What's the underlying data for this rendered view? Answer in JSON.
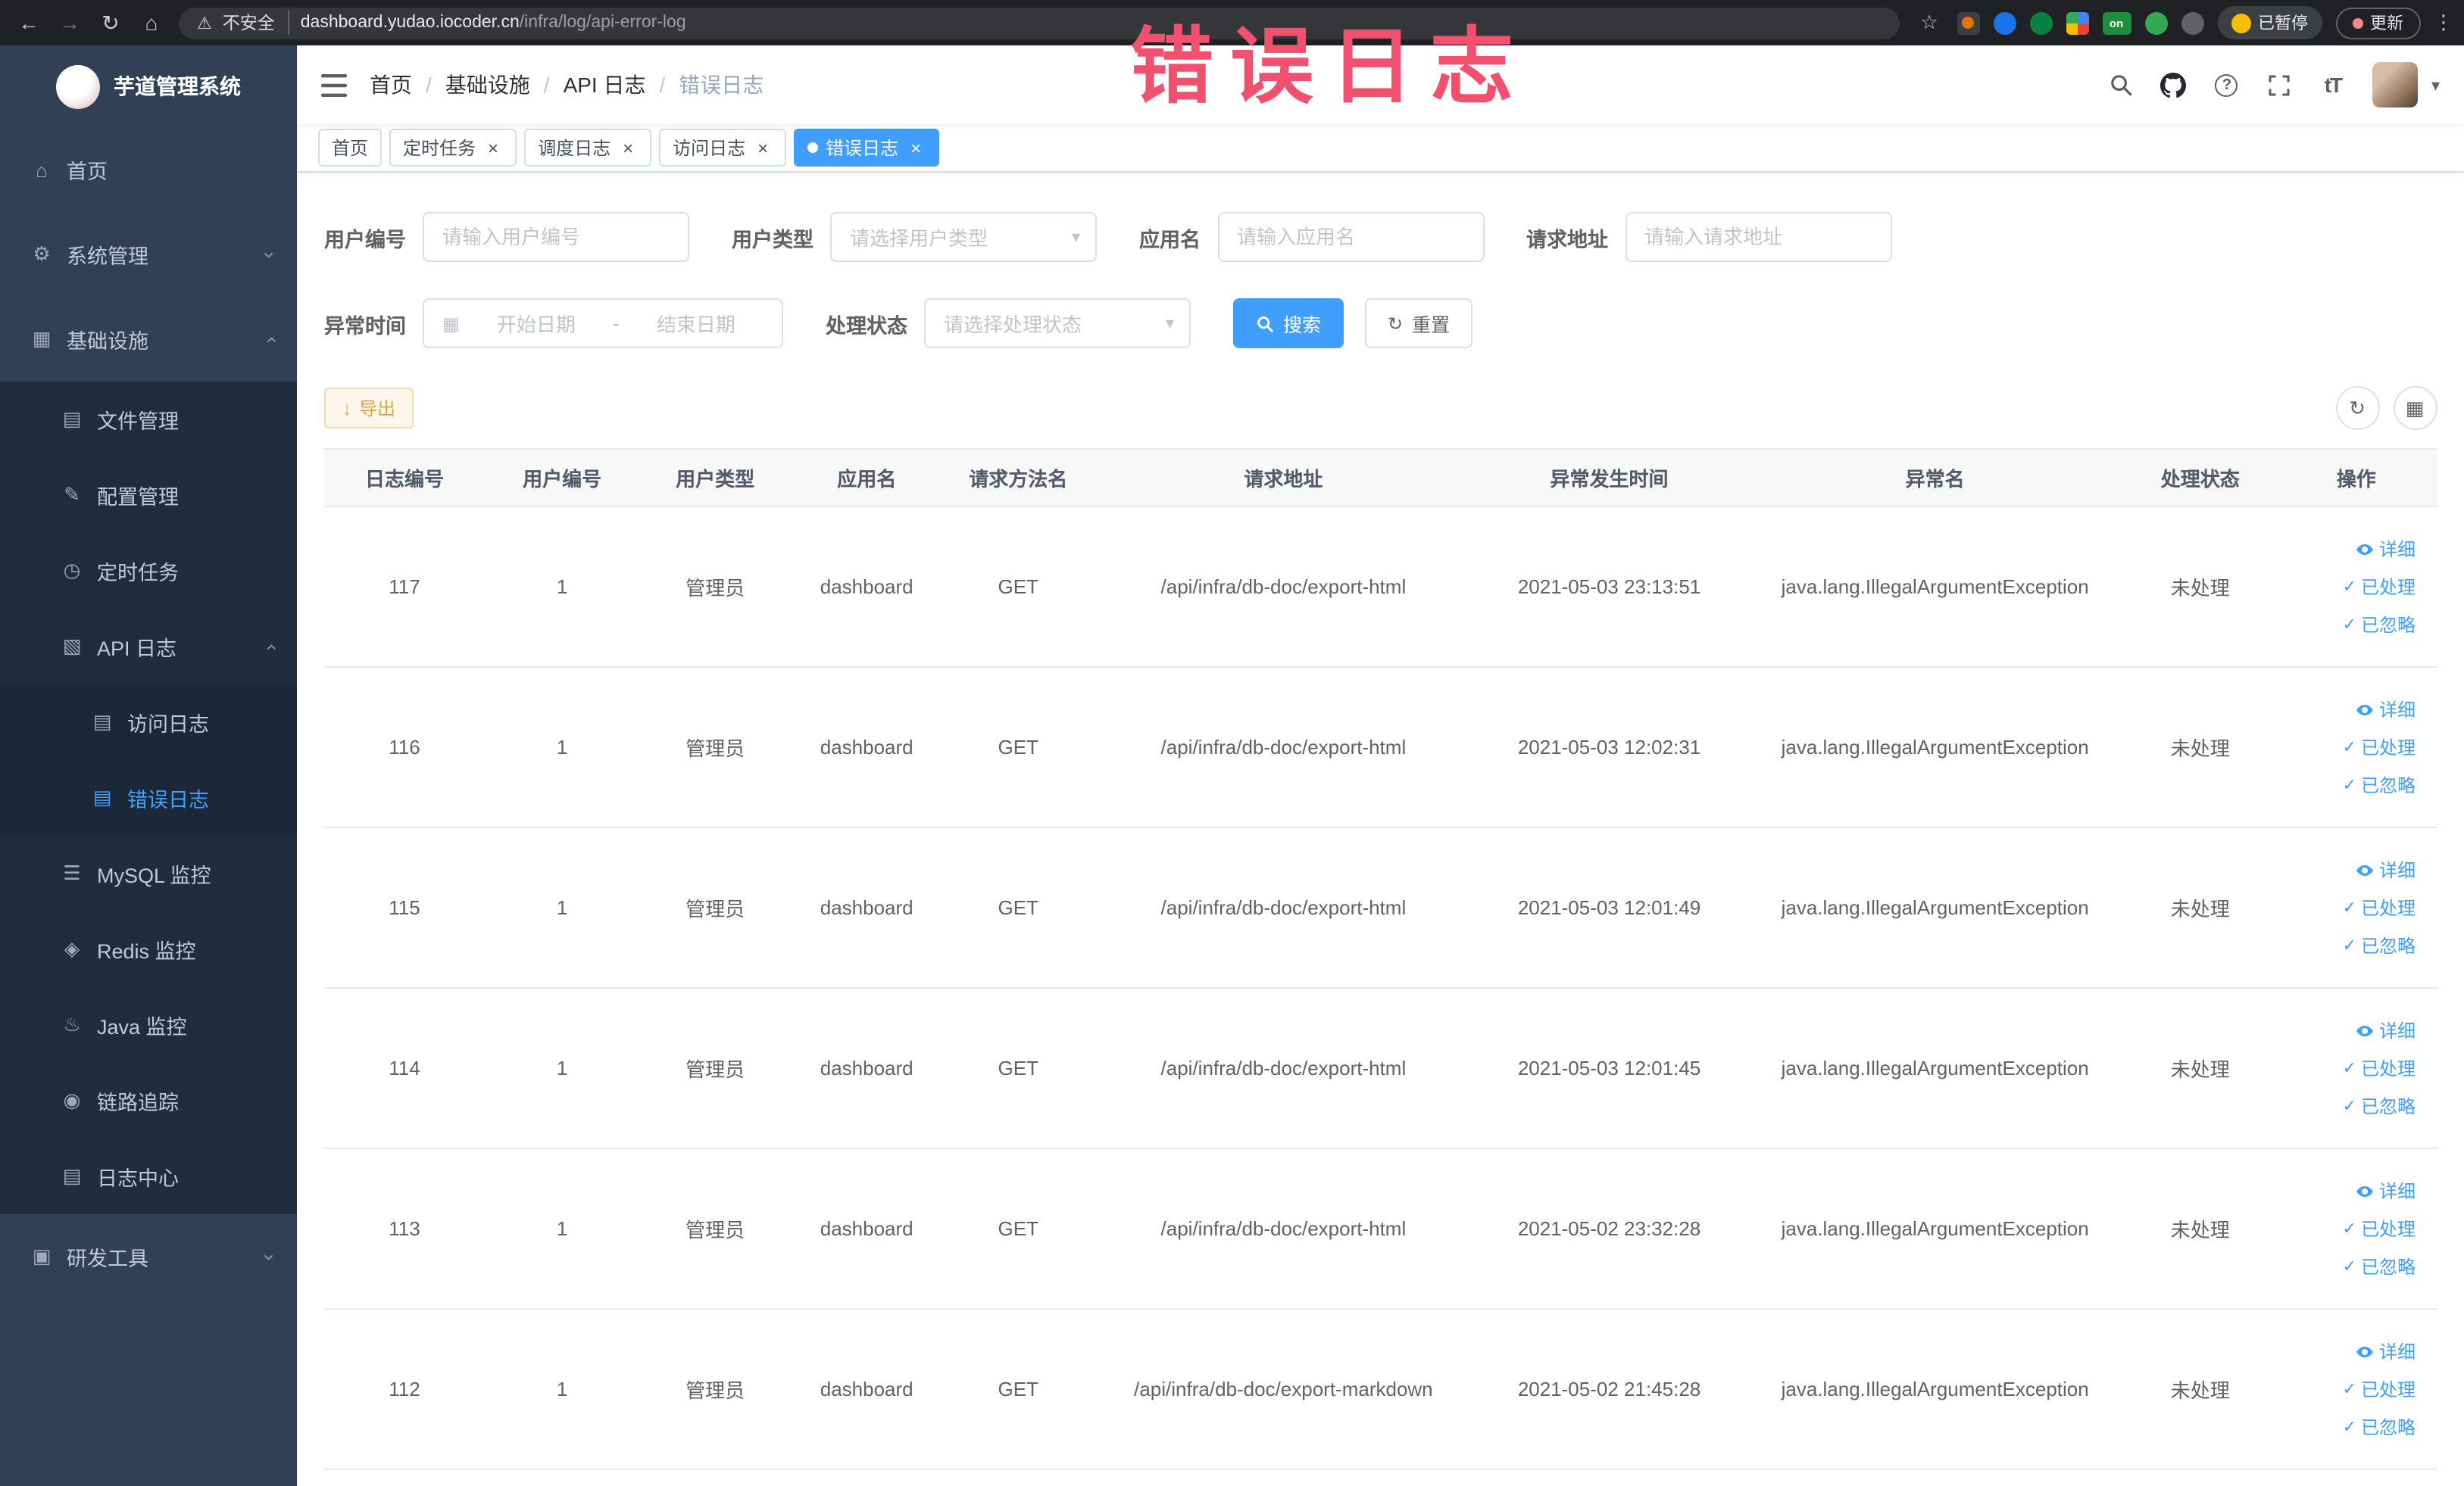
{
  "colors": {
    "accent": "#409eff",
    "warning": "#e6a23c",
    "annotation": "#f1506e",
    "sidebar_bg": "#304156"
  },
  "annotation": {
    "text": "错误日志"
  },
  "browser": {
    "security_label": "不安全",
    "url_host": "dashboard.yudao.iocoder.cn",
    "url_path": "/infra/log/api-error-log",
    "extension_on": "on",
    "paused_label": "已暂停",
    "update_label": "更新"
  },
  "icons": {
    "back": "←",
    "forward": "→",
    "reload": "↻",
    "home_btn": "⌂",
    "warning": "⚠",
    "star": "☆",
    "dots": "⋮",
    "home": "⌂",
    "gear": "⚙",
    "infra": "▦",
    "file": "▤",
    "config": "✎",
    "job": "◷",
    "api_log": "▧",
    "doc": "▤",
    "mysql": "☰",
    "redis": "◈",
    "java": "♨",
    "trace": "◉",
    "log_center": "▤",
    "devtools": "▣",
    "chevron": "›",
    "caret": "▾",
    "close": "×",
    "check": "✓",
    "calendar": "▦",
    "download": "↓",
    "refresh": "↻",
    "columns": "▦",
    "question": "?",
    "font_size": "tT"
  },
  "sidebar": {
    "title": "芋道管理系统",
    "items": [
      {
        "label": "首页"
      },
      {
        "label": "系统管理"
      },
      {
        "label": "基础设施"
      },
      {
        "label": "文件管理"
      },
      {
        "label": "配置管理"
      },
      {
        "label": "定时任务"
      },
      {
        "label": "API 日志"
      },
      {
        "label": "访问日志"
      },
      {
        "label": "错误日志"
      },
      {
        "label": "MySQL 监控"
      },
      {
        "label": "Redis 监控"
      },
      {
        "label": "Java 监控"
      },
      {
        "label": "链路追踪"
      },
      {
        "label": "日志中心"
      },
      {
        "label": "研发工具"
      }
    ]
  },
  "breadcrumb": {
    "separator": "/",
    "items": [
      "首页",
      "基础设施",
      "API 日志",
      "错误日志"
    ]
  },
  "tabs": [
    {
      "label": "首页"
    },
    {
      "label": "定时任务"
    },
    {
      "label": "调度日志"
    },
    {
      "label": "访问日志"
    },
    {
      "label": "错误日志"
    }
  ],
  "filters": {
    "user_id": {
      "label": "用户编号",
      "placeholder": "请输入用户编号"
    },
    "user_type": {
      "label": "用户类型",
      "placeholder": "请选择用户类型"
    },
    "app_name": {
      "label": "应用名",
      "placeholder": "请输入应用名"
    },
    "request_url": {
      "label": "请求地址",
      "placeholder": "请输入请求地址"
    },
    "exception_time": {
      "label": "异常时间",
      "start_placeholder": "开始日期",
      "separator": "-",
      "end_placeholder": "结束日期"
    },
    "process_status": {
      "label": "处理状态",
      "placeholder": "请选择处理状态"
    },
    "search_label": "搜索",
    "reset_label": "重置"
  },
  "toolbar": {
    "export_label": "导出"
  },
  "table": {
    "columns": [
      "日志编号",
      "用户编号",
      "用户类型",
      "应用名",
      "请求方法名",
      "请求地址",
      "异常发生时间",
      "异常名",
      "处理状态",
      "操作"
    ],
    "actions": {
      "detail": "详细",
      "processed": "已处理",
      "ignored": "已忽略"
    },
    "rows": [
      {
        "id": "117",
        "user_id": "1",
        "user_type": "管理员",
        "app": "dashboard",
        "method": "GET",
        "url": "/api/infra/db-doc/export-html",
        "time": "2021-05-03 23:13:51",
        "exception": "java.lang.IllegalArgumentException",
        "status": "未处理"
      },
      {
        "id": "116",
        "user_id": "1",
        "user_type": "管理员",
        "app": "dashboard",
        "method": "GET",
        "url": "/api/infra/db-doc/export-html",
        "time": "2021-05-03 12:02:31",
        "exception": "java.lang.IllegalArgumentException",
        "status": "未处理"
      },
      {
        "id": "115",
        "user_id": "1",
        "user_type": "管理员",
        "app": "dashboard",
        "method": "GET",
        "url": "/api/infra/db-doc/export-html",
        "time": "2021-05-03 12:01:49",
        "exception": "java.lang.IllegalArgumentException",
        "status": "未处理"
      },
      {
        "id": "114",
        "user_id": "1",
        "user_type": "管理员",
        "app": "dashboard",
        "method": "GET",
        "url": "/api/infra/db-doc/export-html",
        "time": "2021-05-03 12:01:45",
        "exception": "java.lang.IllegalArgumentException",
        "status": "未处理"
      },
      {
        "id": "113",
        "user_id": "1",
        "user_type": "管理员",
        "app": "dashboard",
        "method": "GET",
        "url": "/api/infra/db-doc/export-html",
        "time": "2021-05-02 23:32:28",
        "exception": "java.lang.IllegalArgumentException",
        "status": "未处理"
      },
      {
        "id": "112",
        "user_id": "1",
        "user_type": "管理员",
        "app": "dashboard",
        "method": "GET",
        "url": "/api/infra/db-doc/export-markdown",
        "time": "2021-05-02 21:45:28",
        "exception": "java.lang.IllegalArgumentException",
        "status": "未处理"
      }
    ]
  }
}
